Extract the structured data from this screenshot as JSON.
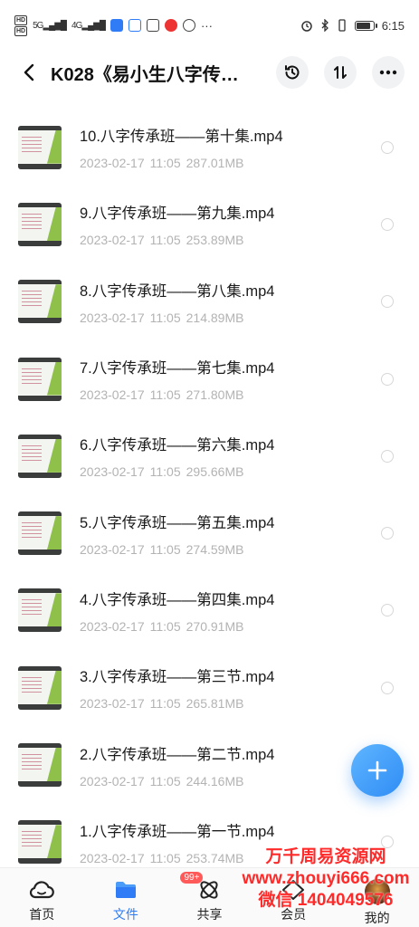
{
  "status_bar": {
    "hd1": "HD",
    "hd2": "HD",
    "signal1": "5G",
    "signal2": "4G",
    "time": "6:15",
    "battery_level": 0.75
  },
  "header": {
    "title": "K028《易小生八字传…",
    "back_icon": "chevron-left-icon",
    "actions": [
      "history-icon",
      "sort-icon",
      "more-icon"
    ]
  },
  "files": [
    {
      "name": "10.八字传承班——第十集.mp4",
      "date": "2023-02-17",
      "time": "11:05",
      "size": "287.01MB"
    },
    {
      "name": "9.八字传承班——第九集.mp4",
      "date": "2023-02-17",
      "time": "11:05",
      "size": "253.89MB"
    },
    {
      "name": "8.八字传承班——第八集.mp4",
      "date": "2023-02-17",
      "time": "11:05",
      "size": "214.89MB"
    },
    {
      "name": "7.八字传承班——第七集.mp4",
      "date": "2023-02-17",
      "time": "11:05",
      "size": "271.80MB"
    },
    {
      "name": "6.八字传承班——第六集.mp4",
      "date": "2023-02-17",
      "time": "11:05",
      "size": "295.66MB"
    },
    {
      "name": "5.八字传承班——第五集.mp4",
      "date": "2023-02-17",
      "time": "11:05",
      "size": "274.59MB"
    },
    {
      "name": "4.八字传承班——第四集.mp4",
      "date": "2023-02-17",
      "time": "11:05",
      "size": "270.91MB"
    },
    {
      "name": "3.八字传承班——第三节.mp4",
      "date": "2023-02-17",
      "time": "11:05",
      "size": "265.81MB"
    },
    {
      "name": "2.八字传承班——第二节.mp4",
      "date": "2023-02-17",
      "time": "11:05",
      "size": "244.16MB"
    },
    {
      "name": "1.八字传承班——第一节.mp4",
      "date": "2023-02-17",
      "time": "11:05",
      "size": "253.74MB"
    }
  ],
  "fab": {
    "icon": "plus-icon"
  },
  "bottom_nav": {
    "items": [
      {
        "label": "首页",
        "icon": "cloud-icon"
      },
      {
        "label": "文件",
        "icon": "folder-icon",
        "active": true
      },
      {
        "label": "共享",
        "icon": "share-atom-icon"
      },
      {
        "label": "会员",
        "icon": "vip-diamond-icon"
      },
      {
        "label": "我的",
        "icon": "avatar"
      }
    ],
    "badge": "99+"
  },
  "watermark": {
    "line1": "万千周易资源网",
    "line2": "www.zhouyi666.com",
    "line3": "微信 1404049576"
  },
  "colors": {
    "accent": "#2f7cf6",
    "fab": "#3b95f7",
    "watermark": "#ff2a2a"
  }
}
